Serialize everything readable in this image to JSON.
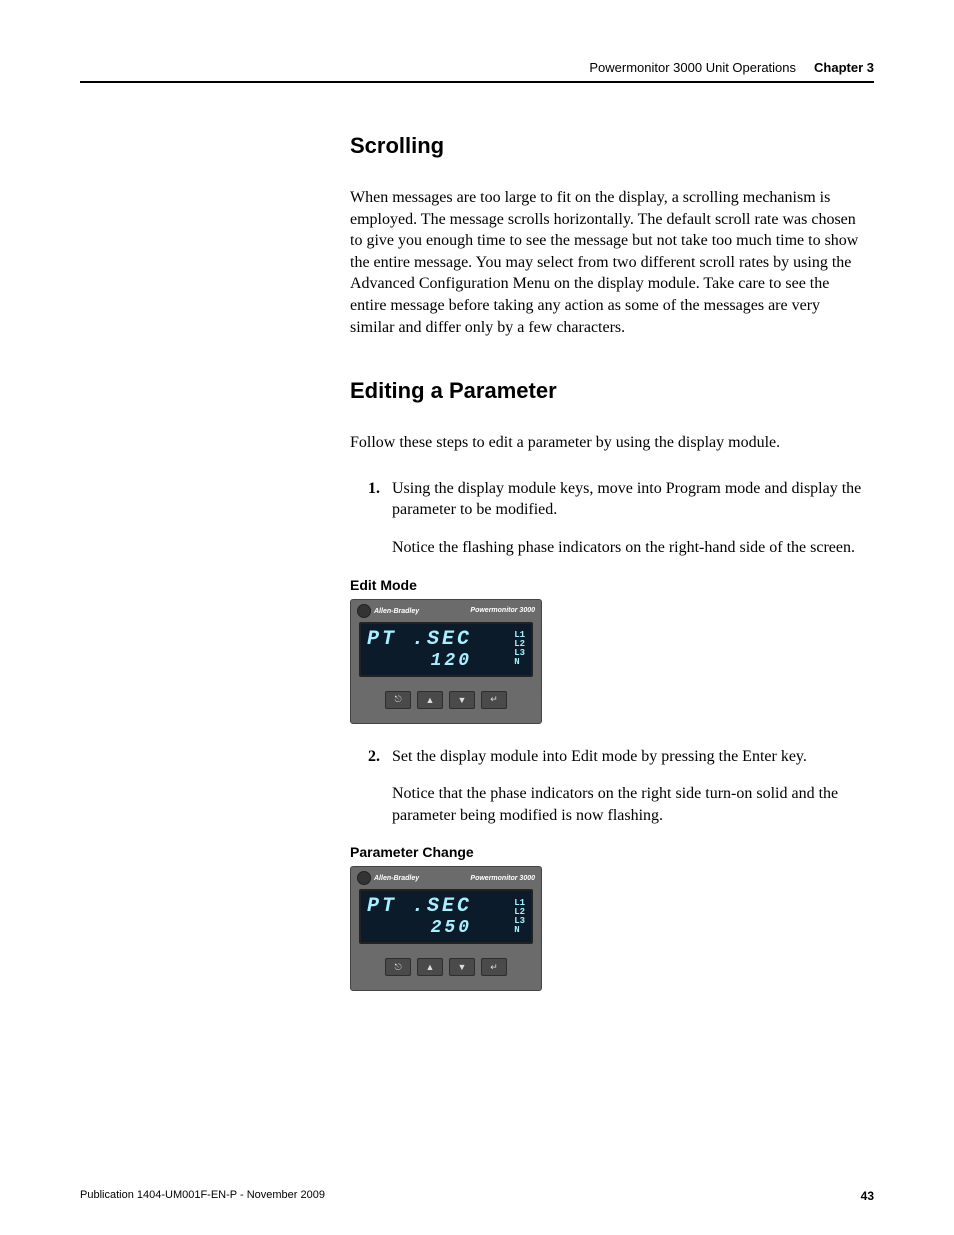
{
  "header": {
    "doc_title": "Powermonitor 3000 Unit Operations",
    "chapter": "Chapter 3"
  },
  "sections": {
    "scrolling": {
      "heading": "Scrolling",
      "body": "When messages are too large to fit on the display, a scrolling mechanism is employed. The message scrolls horizontally. The default scroll rate was chosen to give you enough time to see the message but not take too much time to show the entire message. You may select from two different scroll rates by using the Advanced Configuration Menu on the display module. Take care to see the entire message before taking any action as some of the messages are very similar and differ only by a few characters."
    },
    "editing": {
      "heading": "Editing a Parameter",
      "intro": "Follow these steps to edit a parameter by using the display module.",
      "steps": [
        {
          "text": "Using the display module keys, move into Program mode and display the parameter to be modified.",
          "note": "Notice the flashing phase indicators on the right-hand side of the screen."
        },
        {
          "text": "Set the display module into Edit mode by pressing the Enter key.",
          "note": "Notice that the phase indicators on the right side turn-on solid and the parameter being modified is now flashing."
        }
      ]
    }
  },
  "figures": {
    "edit_mode": {
      "caption": "Edit Mode",
      "brand": "Allen-Bradley",
      "model": "Powermonitor 3000",
      "line1": "PT .SEC",
      "line2": "120",
      "phases": [
        "L1",
        "L2",
        "L3",
        "N"
      ],
      "buttons": {
        "escape": "⎋",
        "up": "▲",
        "down": "▼",
        "enter": "↵"
      }
    },
    "param_change": {
      "caption": "Parameter Change",
      "brand": "Allen-Bradley",
      "model": "Powermonitor 3000",
      "line1": "PT .SEC",
      "line2": "250",
      "phases": [
        "L1",
        "L2",
        "L3",
        "N"
      ],
      "buttons": {
        "escape": "⎋",
        "up": "▲",
        "down": "▼",
        "enter": "↵"
      }
    }
  },
  "footer": {
    "pub": "Publication 1404-UM001F-EN-P - November 2009",
    "page": "43"
  }
}
